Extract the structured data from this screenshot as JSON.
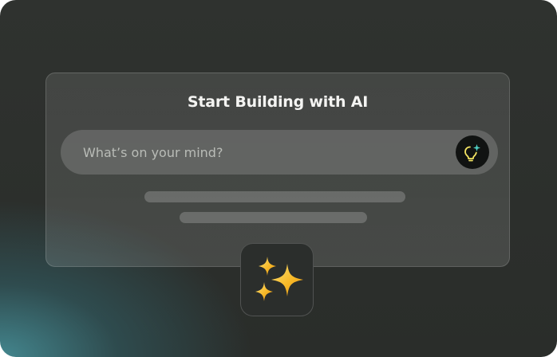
{
  "card": {
    "title": "Start Building with AI"
  },
  "prompt": {
    "placeholder": "What’s on your mind?",
    "value": ""
  },
  "icons": {
    "submit": "lightbulb-sparkle-icon",
    "tile": "sparkles-icon"
  },
  "colors": {
    "accent_teal": "#4fd1c5",
    "accent_yellow": "#f5e663",
    "sparkle_gold": "#f7b928",
    "background": "#2c2f2c",
    "glow": "#3e8f98"
  }
}
